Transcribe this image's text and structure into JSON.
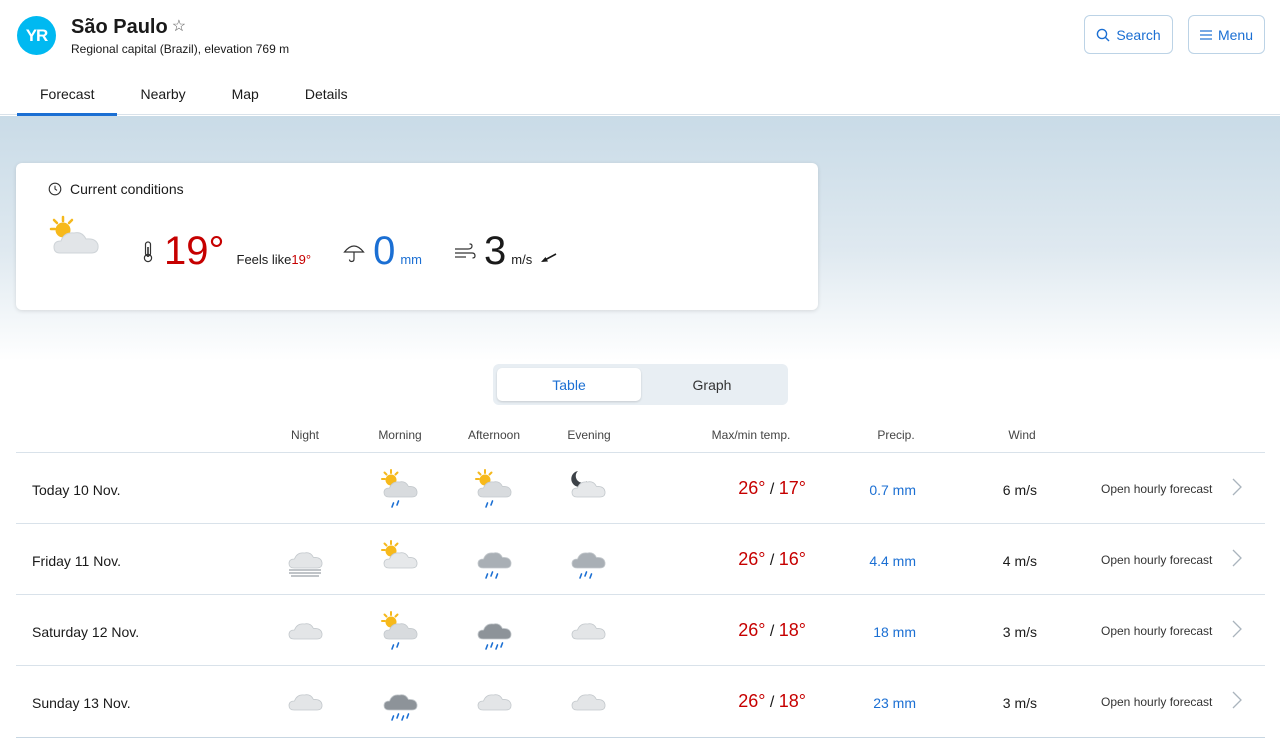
{
  "header": {
    "logo": "YR",
    "place": "São Paulo",
    "favorite_icon": "star-outline-icon",
    "subtitle": "Regional capital (Brazil), elevation 769 m",
    "search_label": "Search",
    "menu_label": "Menu"
  },
  "tabs": [
    {
      "label": "Forecast",
      "active": true
    },
    {
      "label": "Nearby"
    },
    {
      "label": "Map"
    },
    {
      "label": "Details"
    }
  ],
  "current": {
    "heading": "Current conditions",
    "symbol": "partly-cloudy-day",
    "temp": "19°",
    "feels_label": "Feels like ",
    "feels_value": "19°",
    "precip": "0",
    "precip_unit": "mm",
    "wind": "3",
    "wind_unit": "m/s"
  },
  "view_toggle": {
    "table": "Table",
    "graph": "Graph",
    "selected": "Table"
  },
  "columns": {
    "night": "Night",
    "morning": "Morning",
    "afternoon": "Afternoon",
    "evening": "Evening",
    "maxmin": "Max/min temp.",
    "precip": "Precip.",
    "wind": "Wind"
  },
  "rows": [
    {
      "day": "Today 10 Nov.",
      "night": "",
      "morning": "partly-cloudy-light-rain",
      "afternoon": "partly-cloudy-light-rain",
      "evening": "cloudy-night",
      "max": "26°",
      "sep": " / ",
      "min": "17°",
      "precip": "0.7 mm",
      "wind": "6 m/s",
      "open": "Open hourly forecast"
    },
    {
      "day": "Friday 11 Nov.",
      "night": "fog",
      "morning": "partly-cloudy-day",
      "afternoon": "light-rain",
      "evening": "light-rain",
      "max": "26°",
      "sep": " / ",
      "min": "16°",
      "precip": "4.4 mm",
      "wind": "4 m/s",
      "open": "Open hourly forecast"
    },
    {
      "day": "Saturday 12 Nov.",
      "night": "cloudy",
      "morning": "partly-cloudy-light-rain",
      "afternoon": "heavy-rain",
      "evening": "cloudy",
      "max": "26°",
      "sep": " / ",
      "min": "18°",
      "precip": "18 mm",
      "wind": "3 m/s",
      "open": "Open hourly forecast"
    },
    {
      "day": "Sunday 13 Nov.",
      "night": "cloudy",
      "morning": "heavy-rain",
      "afternoon": "cloudy",
      "evening": "cloudy",
      "max": "26°",
      "sep": " / ",
      "min": "18°",
      "precip": "23 mm",
      "wind": "3 m/s",
      "open": "Open hourly forecast"
    }
  ],
  "colors": {
    "accent": "#1b6fd3",
    "temp_warm": "#c60000",
    "logo": "#00b9f1"
  }
}
